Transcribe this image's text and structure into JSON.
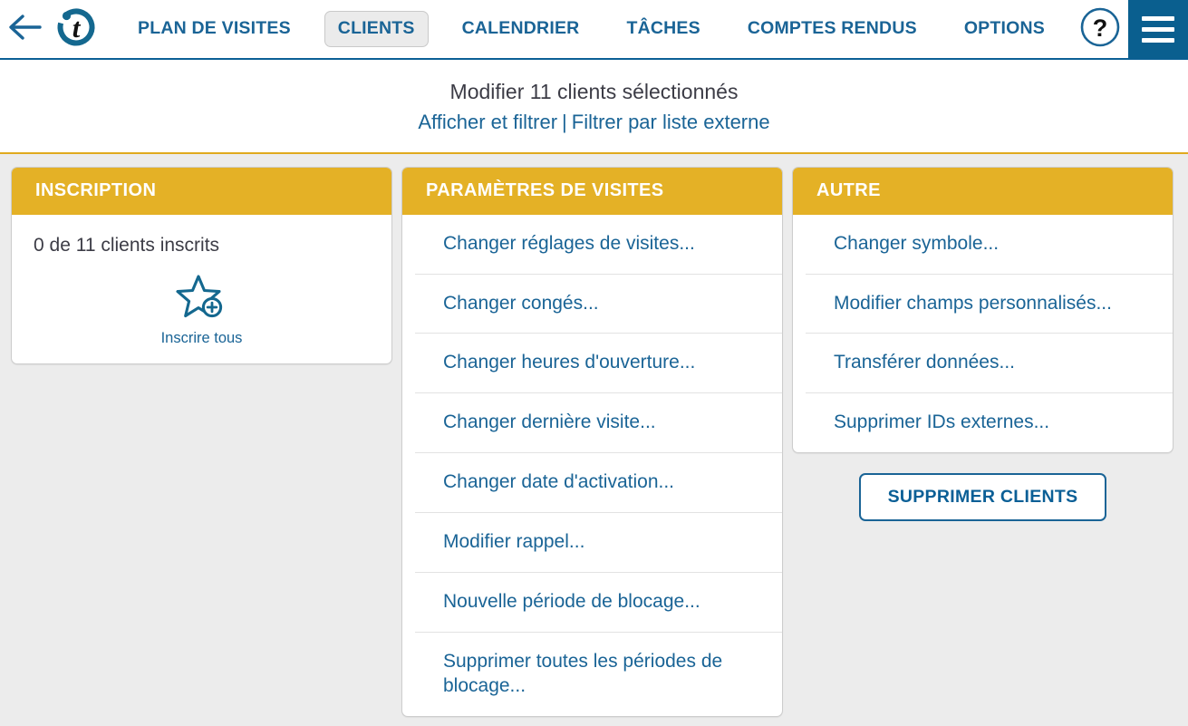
{
  "topbar": {
    "back_icon": "back-arrow-icon",
    "logo_icon": "app-logo-icon",
    "logo_letter": "t",
    "help_icon": "help-question-icon",
    "help_label": "?",
    "menu_icon": "hamburger-menu-icon",
    "nav": [
      {
        "label": "PLAN DE VISITES",
        "active": false
      },
      {
        "label": "CLIENTS",
        "active": true
      },
      {
        "label": "CALENDRIER",
        "active": false
      },
      {
        "label": "TÂCHES",
        "active": false
      },
      {
        "label": "COMPTES RENDUS",
        "active": false
      },
      {
        "label": "OPTIONS",
        "active": false
      }
    ]
  },
  "subheader": {
    "title": "Modifier 11 clients sélectionnés",
    "link_show_filter": "Afficher et filtrer",
    "separator": "|",
    "link_external_list": "Filtrer par liste externe"
  },
  "cards": {
    "inscription": {
      "header": "INSCRIPTION",
      "count_text": "0 de 11 clients inscrits",
      "enroll_icon": "star-plus-icon",
      "enroll_label": "Inscrire tous"
    },
    "visit_settings": {
      "header": "PARAMÈTRES DE VISITES",
      "items": [
        "Changer réglages de visites...",
        "Changer congés...",
        "Changer heures d'ouverture...",
        "Changer dernière visite...",
        "Changer date d'activation...",
        "Modifier rappel...",
        "Nouvelle période de blocage...",
        "Supprimer toutes les périodes de blocage..."
      ]
    },
    "other": {
      "header": "AUTRE",
      "items": [
        "Changer symbole...",
        "Modifier champs personnalisés...",
        "Transférer données...",
        "Supprimer IDs externes..."
      ],
      "delete_button": "SUPPRIMER CLIENTS"
    }
  },
  "colors": {
    "accent_yellow": "#e4b126",
    "link_blue": "#1a6496",
    "brand_blue": "#0a5f8f",
    "page_background": "#ececec"
  }
}
